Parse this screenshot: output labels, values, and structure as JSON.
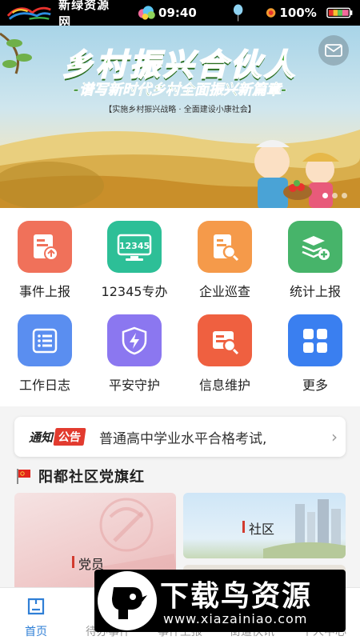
{
  "status_bar": {
    "app_name": "新绿资源网",
    "time": "09:40",
    "battery_percent": "100%"
  },
  "banner": {
    "title": "乡村振兴合伙人",
    "subtitle": "-谱写新时代乡村全面振兴新篇章-",
    "tagline": "【实施乡村振兴战略 · 全面建设小康社会】",
    "slide_count": 3,
    "active_slide": 0
  },
  "grid": {
    "items": [
      {
        "label": "事件上报",
        "icon": "report-upload-icon",
        "color": "#f0715a"
      },
      {
        "label": "12345专办",
        "icon": "hotline-12345-icon",
        "color": "#2dbf97",
        "icon_text": "12345"
      },
      {
        "label": "企业巡查",
        "icon": "enterprise-inspect-icon",
        "color": "#f59a4a"
      },
      {
        "label": "统计上报",
        "icon": "stats-upload-icon",
        "color": "#47b46a"
      },
      {
        "label": "工作日志",
        "icon": "work-log-icon",
        "color": "#5a8ef0"
      },
      {
        "label": "平安守护",
        "icon": "shield-icon",
        "color": "#8b77f0"
      },
      {
        "label": "信息维护",
        "icon": "info-maintain-icon",
        "color": "#ef6040"
      },
      {
        "label": "更多",
        "icon": "more-grid-icon",
        "color": "#3a7ff0"
      }
    ]
  },
  "notice": {
    "tag_a": "通知",
    "tag_b": "公告",
    "text": "普通高中学业水平合格考试,"
  },
  "section": {
    "title": "阳都社区党旗红",
    "cards": [
      {
        "label": "党员"
      },
      {
        "label": "社区"
      }
    ]
  },
  "tabbar": {
    "tabs": [
      {
        "label": "首页",
        "active": true
      },
      {
        "label": "待办事件",
        "active": false
      },
      {
        "label": "事件上报",
        "active": false
      },
      {
        "label": "街道快讯",
        "active": false
      },
      {
        "label": "个人中心",
        "active": false
      }
    ]
  },
  "watermark": {
    "name": "下载鸟资源",
    "url": "www.xiazainiao.com"
  }
}
